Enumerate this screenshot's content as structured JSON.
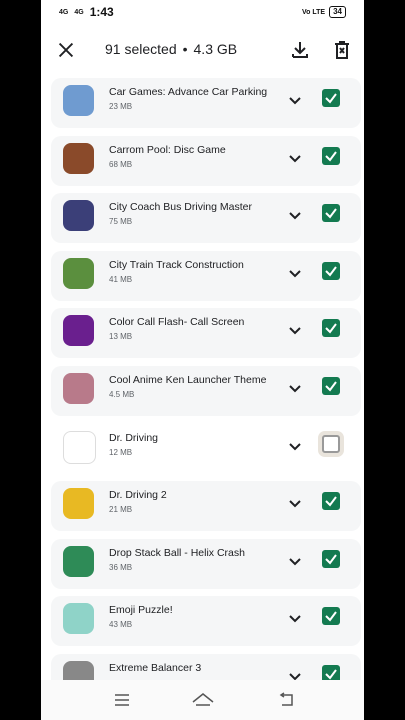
{
  "status": {
    "net1": "4G",
    "net2": "4G",
    "time": "1:43",
    "right_text": "Vo LTE",
    "battery": "34"
  },
  "header": {
    "selected": "91 selected",
    "separator": "•",
    "size": "4.3 GB"
  },
  "apps": [
    {
      "name": "Car Games: Advance Car Parking",
      "size": "23 MB",
      "checked": true,
      "icon": "car-parking-icon",
      "color": "#6f9bd0"
    },
    {
      "name": "Carrom Pool: Disc Game",
      "size": "68 MB",
      "checked": true,
      "icon": "carrom-icon",
      "color": "#8a4a2a"
    },
    {
      "name": "City Coach Bus Driving Master",
      "size": "75 MB",
      "checked": true,
      "icon": "bus-icon",
      "color": "#3b3f78"
    },
    {
      "name": "City Train Track Construction",
      "size": "41 MB",
      "checked": true,
      "icon": "train-icon",
      "color": "#5b8f3e"
    },
    {
      "name": "Color Call Flash- Call Screen",
      "size": "13 MB",
      "checked": true,
      "icon": "color-call-icon",
      "color": "#6a1f8e"
    },
    {
      "name": "Cool Anime Ken Launcher Theme",
      "size": "4.5 MB",
      "checked": true,
      "icon": "anime-icon",
      "color": "#b87a8a"
    },
    {
      "name": "Dr. Driving",
      "size": "12 MB",
      "checked": false,
      "icon": "dr-driving-icon",
      "color": "#ffffff"
    },
    {
      "name": "Dr. Driving 2",
      "size": "21 MB",
      "checked": true,
      "icon": "dr-driving-2-icon",
      "color": "#e8b923"
    },
    {
      "name": "Drop Stack Ball - Helix Crash",
      "size": "36 MB",
      "checked": true,
      "icon": "helix-icon",
      "color": "#2e8b57"
    },
    {
      "name": "Emoji Puzzle!",
      "size": "43 MB",
      "checked": true,
      "icon": "emoji-puzzle-icon",
      "color": "#8fd3c8"
    },
    {
      "name": "Extreme Balancer 3",
      "size": "",
      "checked": true,
      "icon": "balancer-icon",
      "color": "#888888"
    }
  ],
  "accent": "#137a50"
}
